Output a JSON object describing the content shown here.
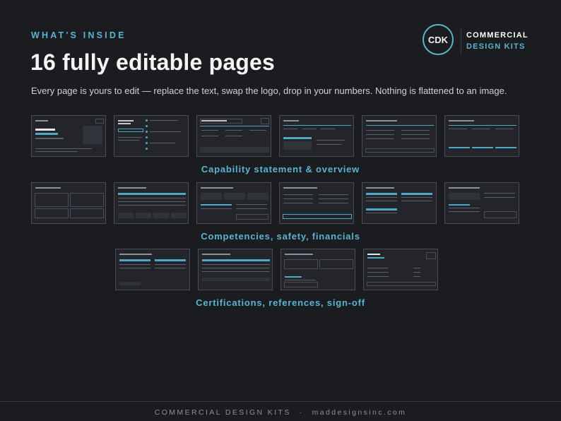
{
  "header": {
    "eyebrow": "WHAT'S INSIDE",
    "title": "16 fully editable pages",
    "subtitle": "Every page is yours to edit — replace the text, swap the logo, drop in your numbers. Nothing is flattened to an image."
  },
  "brand": {
    "logo_text": "CDK",
    "line1": "COMMERCIAL",
    "line2": "DESIGN KITS"
  },
  "sections": [
    {
      "caption": "Capability statement & overview",
      "page_count": 6
    },
    {
      "caption": "Competencies, safety, financials",
      "page_count": 6
    },
    {
      "caption": "Certifications, references, sign-off",
      "page_count": 4
    }
  ],
  "footer": {
    "left": "COMMERCIAL DESIGN KITS",
    "separator": "·",
    "right": "maddesignsinc.com"
  },
  "colors": {
    "background": "#1b1c20",
    "accent": "#5ab4d0",
    "thumb_border": "#4a4d55"
  }
}
